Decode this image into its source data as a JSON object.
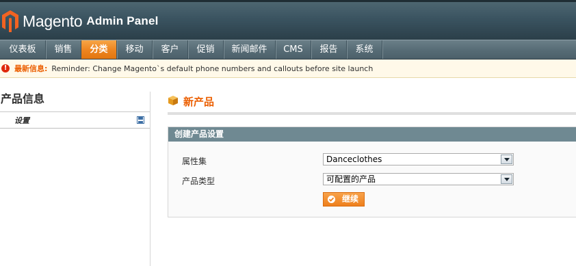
{
  "header": {
    "logo_text": "Magento",
    "logo_sub": "Admin Panel"
  },
  "nav": {
    "items": [
      {
        "label": "仪表板",
        "active": false
      },
      {
        "label": "销售",
        "active": false
      },
      {
        "label": "分类",
        "active": true
      },
      {
        "label": "移动",
        "active": false
      },
      {
        "label": "客户",
        "active": false
      },
      {
        "label": "促销",
        "active": false
      },
      {
        "label": "新闻邮件",
        "active": false
      },
      {
        "label": "CMS",
        "active": false
      },
      {
        "label": "报告",
        "active": false
      },
      {
        "label": "系统",
        "active": false
      }
    ]
  },
  "message": {
    "title": "最新信息:",
    "text": "Reminder: Change Magento`s default phone numbers and callouts before site launch"
  },
  "sidebar": {
    "title": "产品信息",
    "tab_label": "设置"
  },
  "main": {
    "page_title": "新产品",
    "fieldset_title": "创建产品设置",
    "attribute_set_label": "属性集",
    "attribute_set_value": "Danceclothes",
    "product_type_label": "产品类型",
    "product_type_value": "可配置的产品",
    "continue_label": "继续"
  },
  "colors": {
    "accent": "#eb5e00",
    "nav_active": "#ee8621",
    "fieldset_head": "#6f8992"
  }
}
